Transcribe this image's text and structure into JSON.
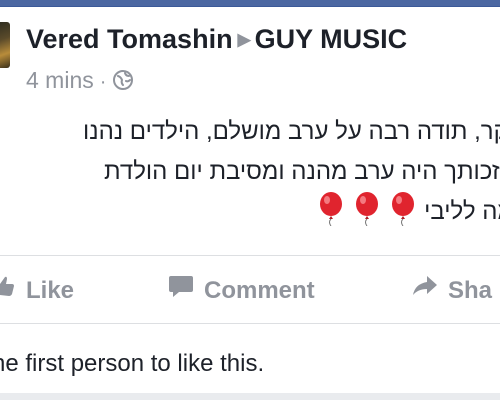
{
  "post": {
    "author": "Vered Tomashin",
    "target": "GUY MUSIC",
    "arrow_glyph": "▶",
    "time": "4 mins",
    "separator": "·",
    "privacy_icon": "globe-icon",
    "text_lines": [
      "יקר, תודה רבה על ערב מושלם, הילדים נהנו",
      "בזכותך היה ערב מהנה ומסיבת יום הולדת",
      "מה לליבי"
    ],
    "emoji": [
      "balloon",
      "balloon",
      "balloon"
    ]
  },
  "actions": {
    "like": "Like",
    "comment": "Comment",
    "share": "Sha"
  },
  "footer": {
    "text": "he first person to like this."
  },
  "colors": {
    "brand": "#3b5998",
    "muted": "#90949c",
    "text": "#1d2129",
    "balloon": "#e0242e"
  }
}
